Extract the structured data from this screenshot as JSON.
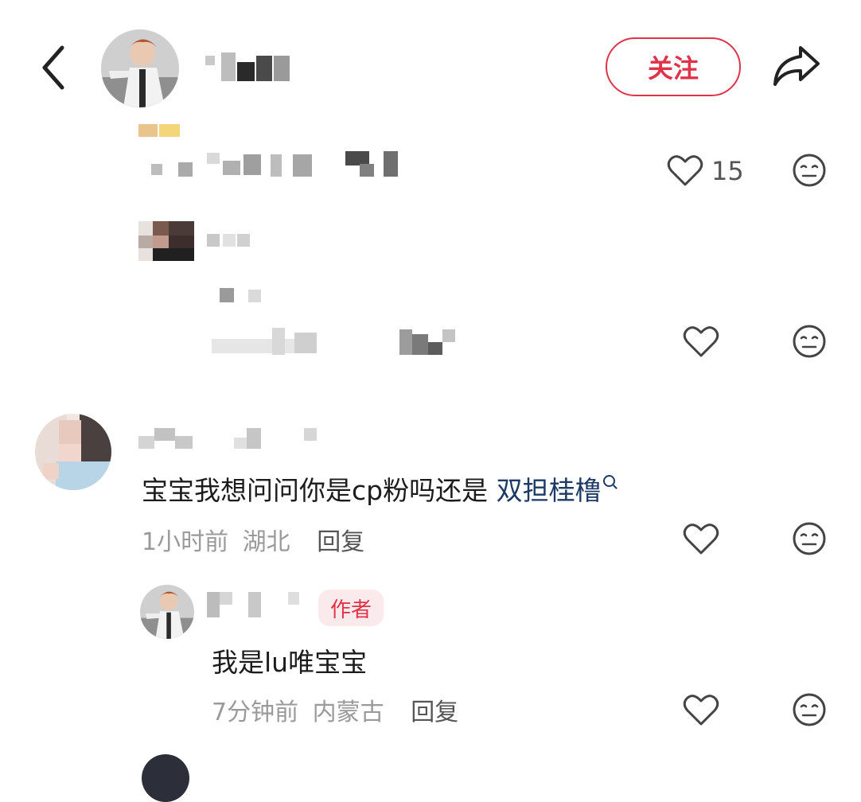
{
  "header": {
    "back_icon": "chevron-left-icon",
    "follow_label": "关注",
    "share_icon": "share-arrow-icon",
    "accent_color": "#e0334a"
  },
  "thread": [
    {
      "id": "c1",
      "likes": "15",
      "like_icon": "heart-outline-icon",
      "dislike_icon": "meh-face-icon"
    },
    {
      "id": "c1-reply",
      "like_icon": "heart-outline-icon",
      "dislike_icon": "meh-face-icon"
    },
    {
      "id": "c2",
      "text_before": "宝宝我想问问你是cp粉吗还是",
      "topic_link": "双担桂橹",
      "topic_icon": "search-icon",
      "time": "1小时前",
      "location": "湖北",
      "reply_label": "回复",
      "like_icon": "heart-outline-icon",
      "dislike_icon": "meh-face-icon"
    },
    {
      "id": "c2-reply",
      "author_badge": "作者",
      "text": "我是lu唯宝宝",
      "time": "7分钟前",
      "location": "内蒙古",
      "reply_label": "回复",
      "like_icon": "heart-outline-icon",
      "dislike_icon": "meh-face-icon"
    }
  ]
}
